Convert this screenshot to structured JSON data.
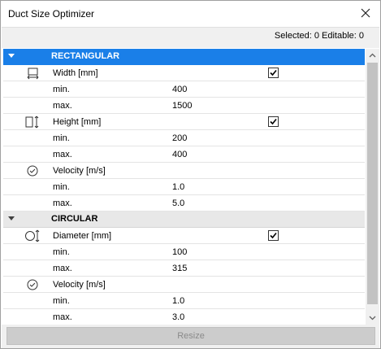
{
  "window": {
    "title": "Duct Size Optimizer",
    "close_icon": "close-icon"
  },
  "status": {
    "text": "Selected: 0 Editable: 0"
  },
  "groups": [
    {
      "label": "RECTANGULAR",
      "selected": true,
      "params": [
        {
          "name": "Width [mm]",
          "icon": "width-icon",
          "checked": true,
          "min_label": "min.",
          "min": "400",
          "max_label": "max.",
          "max": "1500"
        },
        {
          "name": "Height [mm]",
          "icon": "height-icon",
          "checked": true,
          "min_label": "min.",
          "min": "200",
          "max_label": "max.",
          "max": "400"
        },
        {
          "name": "Velocity [m/s]",
          "icon": "velocity-icon",
          "checked": false,
          "min_label": "min.",
          "min": "1.0",
          "max_label": "max.",
          "max": "5.0"
        }
      ]
    },
    {
      "label": "CIRCULAR",
      "selected": false,
      "params": [
        {
          "name": "Diameter [mm]",
          "icon": "diameter-icon",
          "checked": true,
          "min_label": "min.",
          "min": "100",
          "max_label": "max.",
          "max": "315"
        },
        {
          "name": "Velocity [m/s]",
          "icon": "velocity-icon",
          "checked": false,
          "min_label": "min.",
          "min": "1.0",
          "max_label": "max.",
          "max": "3.0"
        }
      ]
    }
  ],
  "footer": {
    "resize_label": "Resize"
  },
  "colors": {
    "selected_row": "#1a7fe8",
    "group_row": "#e8e8e8",
    "disabled_button": "#cccccc"
  }
}
